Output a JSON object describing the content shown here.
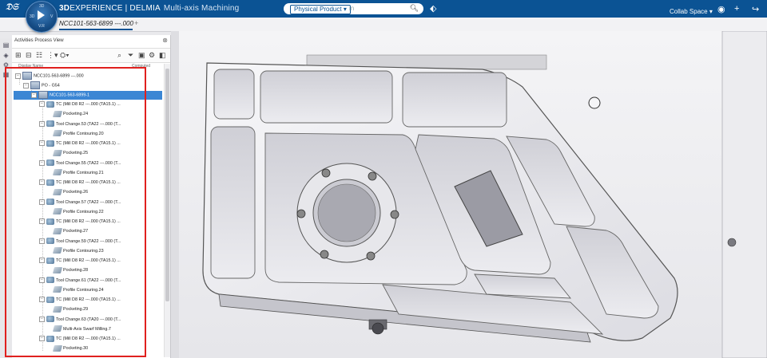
{
  "header": {
    "brand_prefix": "3D",
    "brand_main": "EXPERIENCE | DELMIA",
    "app_name": "Multi-axis Machining",
    "search_scope": "Physical Product",
    "collab_space": "Collab Space",
    "compass_labels": {
      "top": "3D",
      "left": "3D",
      "right": "V",
      "bottom": "V.R"
    }
  },
  "tab": {
    "title": "NCC101-563-6899 ---.000",
    "add": "+"
  },
  "panel": {
    "title": "Activities Process View",
    "col_name": "Display Name",
    "col_computed": "Computed",
    "close": "⊗"
  },
  "tree": {
    "root": "NCC101-563-6899 ---.000",
    "po": "PO - G54",
    "program": "NCC101-563-6899-1",
    "items": [
      {
        "kind": "tc",
        "label": "TC (Mill D8 R2 ---.000 (TA15.1) ..."
      },
      {
        "kind": "op",
        "label": "Pocketing.24"
      },
      {
        "kind": "tc",
        "label": "Tool Change.53 (TA22 ---.000 (T..."
      },
      {
        "kind": "op",
        "label": "Profile Contouring.20"
      },
      {
        "kind": "tc",
        "label": "TC (Mill D8 R2 ---.000 (TA15.1) ..."
      },
      {
        "kind": "op",
        "label": "Pocketing.25"
      },
      {
        "kind": "tc",
        "label": "Tool Change.55 (TA22 ---.000 (T..."
      },
      {
        "kind": "op",
        "label": "Profile Contouring.21"
      },
      {
        "kind": "tc",
        "label": "TC (Mill D8 R2 ---.000 (TA15.1) ..."
      },
      {
        "kind": "op",
        "label": "Pocketing.26"
      },
      {
        "kind": "tc",
        "label": "Tool Change.57 (TA22 ---.000 (T..."
      },
      {
        "kind": "op",
        "label": "Profile Contouring.22"
      },
      {
        "kind": "tc",
        "label": "TC (Mill D8 R2 ---.000 (TA15.1) ..."
      },
      {
        "kind": "op",
        "label": "Pocketing.27"
      },
      {
        "kind": "tc",
        "label": "Tool Change.59 (TA22 ---.000 (T..."
      },
      {
        "kind": "op",
        "label": "Profile Contouring.23"
      },
      {
        "kind": "tc",
        "label": "TC (Mill D8 R2 ---.000 (TA15.1) ..."
      },
      {
        "kind": "op",
        "label": "Pocketing.28"
      },
      {
        "kind": "tc",
        "label": "Tool Change.61 (TA22 ---.000 (T..."
      },
      {
        "kind": "op",
        "label": "Profile Contouring.24"
      },
      {
        "kind": "tc",
        "label": "TC (Mill D8 R2 ---.000 (TA15.1) ..."
      },
      {
        "kind": "op",
        "label": "Pocketing.29"
      },
      {
        "kind": "tc",
        "label": "Tool Change.63 (TA20 ---.000 (T..."
      },
      {
        "kind": "op",
        "label": "Multi-Axis Swarf Milling.7"
      },
      {
        "kind": "tc",
        "label": "TC (Mill D8 R2 ---.000 (TA15.1) ..."
      },
      {
        "kind": "op",
        "label": "Pocketing.30"
      }
    ]
  },
  "colors": {
    "topbar": "#0b5394",
    "selection": "#3b86d4",
    "highlight_box": "#e0201e"
  }
}
